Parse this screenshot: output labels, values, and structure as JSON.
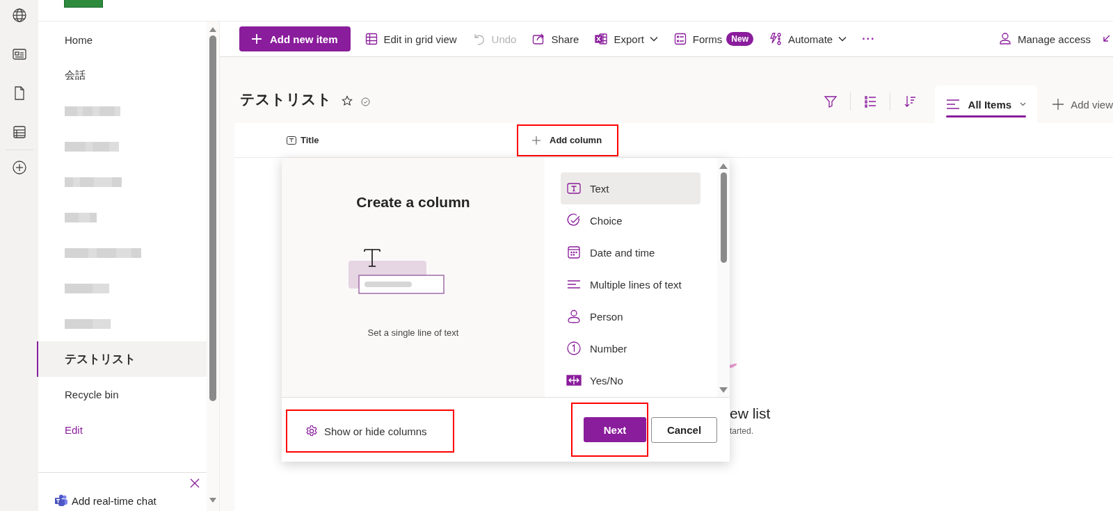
{
  "app_rail": {
    "items": [
      {
        "kind": "globe"
      },
      {
        "kind": "news"
      },
      {
        "kind": "document"
      },
      {
        "kind": "list"
      },
      {
        "kind": "add"
      }
    ]
  },
  "nav": {
    "items": [
      {
        "kind": "link",
        "label": "Home",
        "selected": false
      },
      {
        "kind": "link",
        "label": "会話",
        "selected": false
      },
      {
        "kind": "redacted"
      },
      {
        "kind": "redacted"
      },
      {
        "kind": "redacted"
      },
      {
        "kind": "redacted"
      },
      {
        "kind": "redacted"
      },
      {
        "kind": "redacted"
      },
      {
        "kind": "redacted"
      },
      {
        "kind": "link",
        "label": "テストリスト",
        "selected": true
      },
      {
        "kind": "link",
        "label": "Recycle bin",
        "selected": false
      },
      {
        "kind": "edit",
        "label": "Edit",
        "selected": false
      }
    ],
    "chat": {
      "label": "Add real-time chat"
    }
  },
  "toolbar": {
    "items": [
      {
        "kind": "primary",
        "label": "Add new item"
      },
      {
        "kind": "grid",
        "label": "Edit in grid view",
        "disabled": false,
        "dropdown": false
      },
      {
        "kind": "undo",
        "label": "Undo",
        "disabled": true,
        "dropdown": false
      },
      {
        "kind": "share",
        "label": "Share",
        "disabled": false,
        "dropdown": false
      },
      {
        "kind": "export",
        "label": "Export",
        "disabled": false,
        "dropdown": true
      },
      {
        "kind": "forms",
        "label": "Forms",
        "badge": "New",
        "disabled": false,
        "dropdown": false
      },
      {
        "kind": "automate",
        "label": "Automate",
        "disabled": false,
        "dropdown": true
      },
      {
        "kind": "more",
        "label": "···"
      }
    ],
    "right": [
      {
        "label": "Manage access"
      }
    ]
  },
  "list": {
    "title": "テストリスト",
    "views": [
      {
        "label": "All Items",
        "selected": true
      }
    ],
    "add_view": "Add view"
  },
  "table": {
    "columns": [
      {
        "label": "Title"
      }
    ],
    "add_column": {
      "label": "Add column",
      "highlighted": true
    }
  },
  "empty_state": {
    "title": "ew list",
    "subtitle": "tarted."
  },
  "dialog": {
    "title": "Create a column",
    "description": "Set a single line of text",
    "types": [
      {
        "kind": "text",
        "label": "Text",
        "selected": true
      },
      {
        "kind": "choice",
        "label": "Choice",
        "selected": false
      },
      {
        "kind": "date",
        "label": "Date and time",
        "selected": false
      },
      {
        "kind": "multiline",
        "label": "Multiple lines of text",
        "selected": false
      },
      {
        "kind": "person",
        "label": "Person",
        "selected": false
      },
      {
        "kind": "number",
        "label": "Number",
        "selected": false
      },
      {
        "kind": "yesno",
        "label": "Yes/No",
        "selected": false
      }
    ],
    "show_hide": {
      "label": "Show or hide columns",
      "highlighted": true
    },
    "next": {
      "label": "Next",
      "highlighted": true
    },
    "cancel": {
      "label": "Cancel",
      "highlighted": false
    }
  }
}
